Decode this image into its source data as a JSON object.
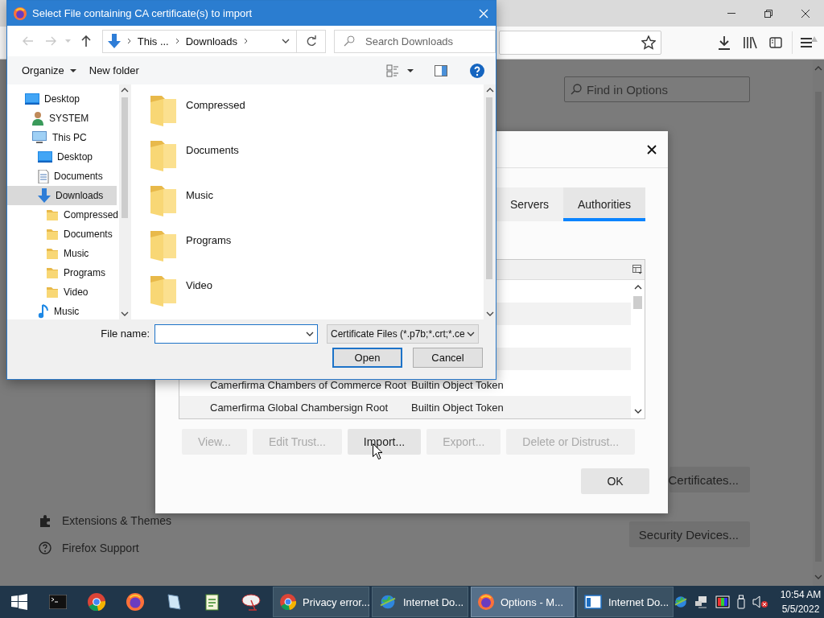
{
  "browser": {
    "find_placeholder": "Find in Options",
    "sidebar_items": [
      {
        "label": "Extensions & Themes",
        "kind": "puzzle"
      },
      {
        "label": "Firefox Support",
        "kind": "help"
      }
    ],
    "buttons": [
      "Certificates...",
      "Security Devices..."
    ]
  },
  "certificate_manager": {
    "tabs": [
      {
        "label": "Servers",
        "selected": false
      },
      {
        "label": "Authorities",
        "selected": true
      }
    ],
    "rows": [
      {
        "column_1": "Camerfirma Chambers of Commerce Root",
        "column_2": "Builtin Object Token"
      },
      {
        "column_1": "Camerfirma Global Chambersign Root",
        "column_2": "Builtin Object Token"
      }
    ],
    "buttons": [
      {
        "label": "View...",
        "disabled": true
      },
      {
        "label": "Edit Trust...",
        "disabled": true
      },
      {
        "label": "Import...",
        "disabled": false
      },
      {
        "label": "Export...",
        "disabled": true
      },
      {
        "label": "Delete or Distrust...",
        "disabled": true
      }
    ],
    "ok_button": "OK"
  },
  "file_dialog": {
    "title": "Select File containing CA certificate(s) to import",
    "breadcrumb": [
      "This ...",
      "Downloads"
    ],
    "search_placeholder": "Search Downloads",
    "toolbar": [
      "Organize",
      "New folder"
    ],
    "tree": [
      {
        "label": "Desktop",
        "kind": "desktop",
        "selected": false,
        "children": [
          {
            "label": "SYSTEM",
            "kind": "user",
            "selected": false
          },
          {
            "label": "This PC",
            "kind": "pc",
            "selected": false,
            "children": [
              {
                "label": "Desktop",
                "kind": "desktop",
                "selected": false
              },
              {
                "label": "Documents",
                "kind": "documents",
                "selected": false
              },
              {
                "label": "Downloads",
                "kind": "downloads",
                "selected": true,
                "children": [
                  {
                    "label": "Compressed",
                    "kind": "folder",
                    "selected": false
                  },
                  {
                    "label": "Documents",
                    "kind": "folder",
                    "selected": false
                  },
                  {
                    "label": "Music",
                    "kind": "folder",
                    "selected": false
                  },
                  {
                    "label": "Programs",
                    "kind": "folder",
                    "selected": false
                  },
                  {
                    "label": "Video",
                    "kind": "folder",
                    "selected": false
                  }
                ]
              },
              {
                "label": "Music",
                "kind": "music",
                "selected": false
              }
            ]
          }
        ]
      }
    ],
    "files": [
      "Compressed",
      "Documents",
      "Music",
      "Programs",
      "Video"
    ],
    "file_name_label": "File name:",
    "file_type": "Certificate Files (*.p7b;*.crt;*.ce",
    "buttons": [
      "Open",
      "Cancel"
    ]
  },
  "taskbar": {
    "tasks": [
      {
        "label": "Privacy error...",
        "kind": "chrome",
        "selected": false
      },
      {
        "label": "Internet Do...",
        "kind": "globe",
        "selected": false
      },
      {
        "label": "Options - M...",
        "kind": "firefox",
        "selected": true
      },
      {
        "label": "Internet Do...",
        "kind": "window",
        "selected": false
      }
    ],
    "time": "10:54 AM",
    "date": "5/5/2022"
  }
}
